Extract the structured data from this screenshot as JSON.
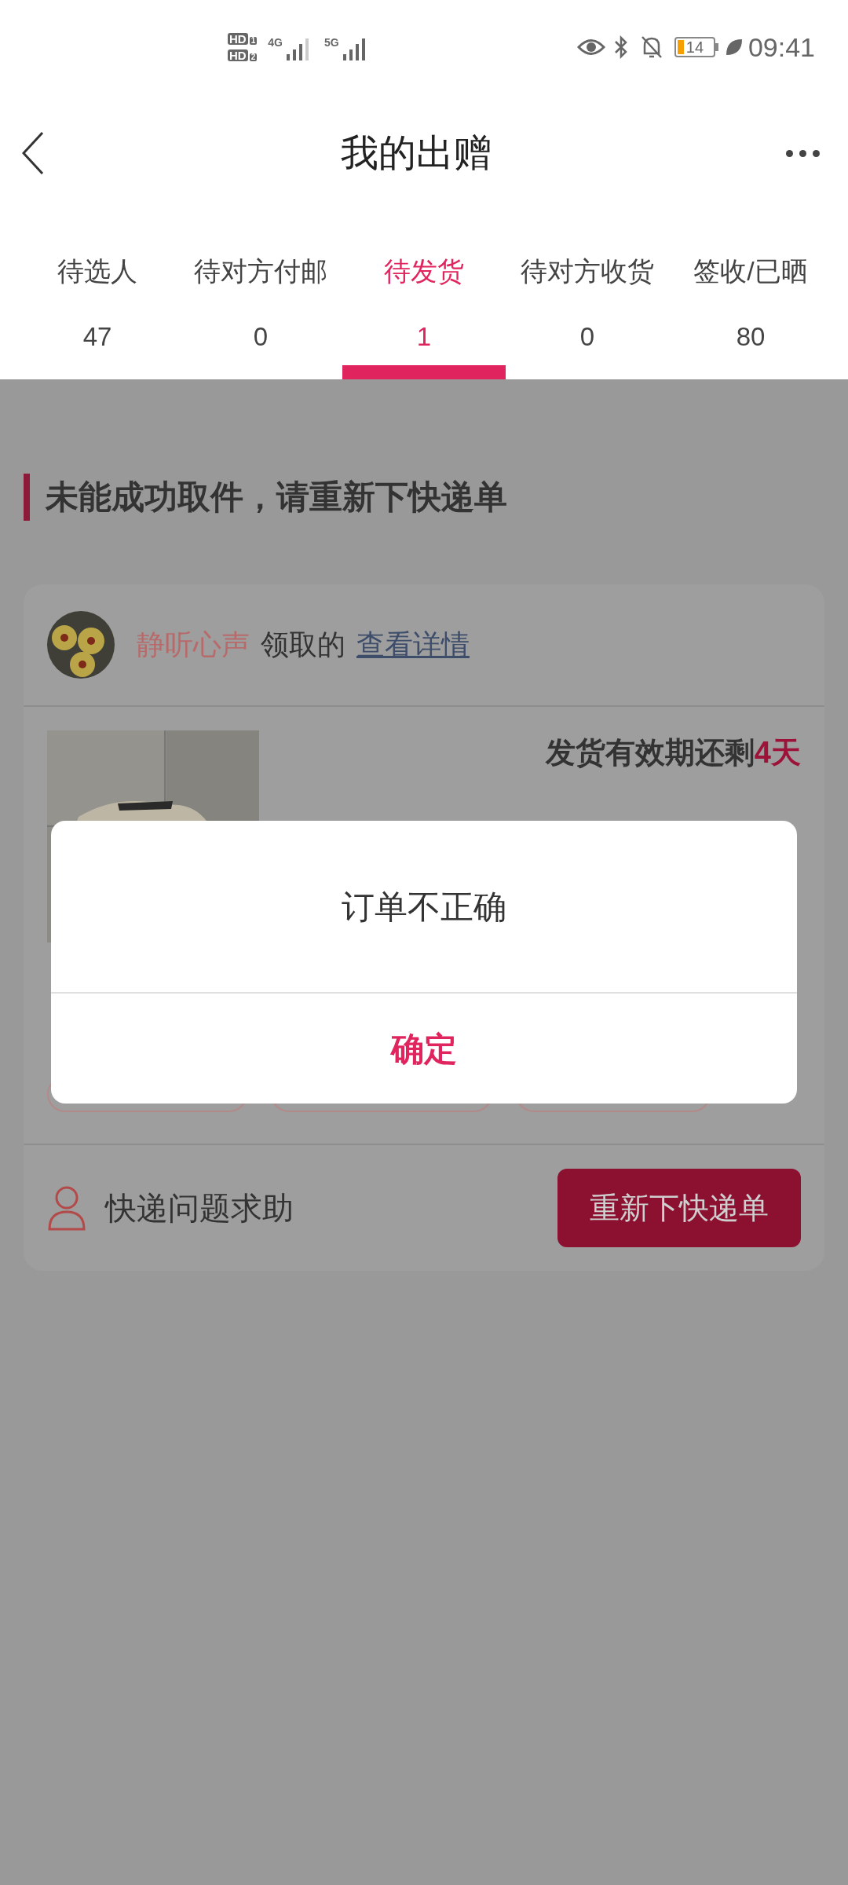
{
  "status_bar": {
    "hd_badges": [
      {
        "label": "HD",
        "slot": "1"
      },
      {
        "label": "HD",
        "slot": "2"
      }
    ],
    "networks": [
      "4G",
      "5G"
    ],
    "battery": "14",
    "time": "09:41"
  },
  "header": {
    "title": "我的出赠"
  },
  "tabs": [
    {
      "label": "待选人",
      "count": "47",
      "selected": false
    },
    {
      "label": "待对方付邮",
      "count": "0",
      "selected": false
    },
    {
      "label": "待发货",
      "count": "1",
      "selected": true
    },
    {
      "label": "待对方收货",
      "count": "0",
      "selected": false
    },
    {
      "label": "签收/已晒",
      "count": "80",
      "selected": false
    }
  ],
  "notice": {
    "title": "未能成功取件，请重新下快递单"
  },
  "order": {
    "claimer": "静听心声",
    "claimed_text": "领取的",
    "details_link": "查看详情",
    "deadline_label": "发货有效期还剩",
    "deadline_value": "4天",
    "help": "快递问题求助",
    "action": "重新下快递单"
  },
  "dialog": {
    "message": "订单不正确",
    "confirm": "确定"
  }
}
